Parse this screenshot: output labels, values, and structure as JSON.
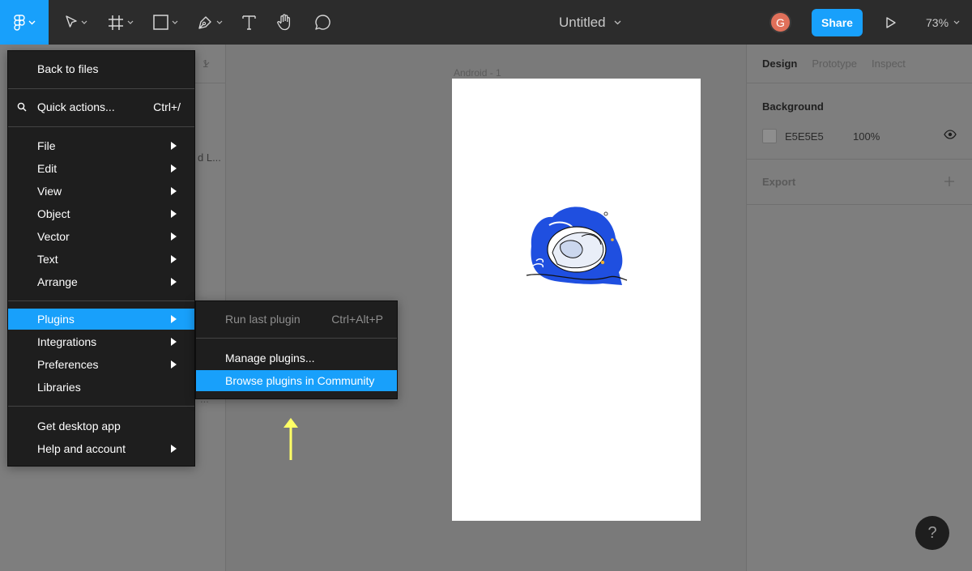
{
  "app": {
    "file_title": "Untitled",
    "avatar_initial": "G",
    "share_label": "Share",
    "zoom_level": "73%",
    "accent_color": "#18a0fb"
  },
  "toolbar": {
    "tools": [
      "figma-menu-icon",
      "move-icon",
      "frame-icon",
      "rectangle-icon",
      "pen-icon",
      "text-icon",
      "hand-icon",
      "comment-icon"
    ]
  },
  "left_panel": {
    "fragment_1": "1",
    "fragment_2": "d L...",
    "fragment_3": "..."
  },
  "canvas": {
    "frame_label": "Android - 1"
  },
  "right_panel": {
    "tabs": [
      "Design",
      "Prototype",
      "Inspect"
    ],
    "background_title": "Background",
    "background_hex": "E5E5E5",
    "background_opacity": "100%",
    "export_title": "Export"
  },
  "main_menu": {
    "back_to_files": "Back to files",
    "quick_actions": "Quick actions...",
    "quick_actions_shortcut": "Ctrl+/",
    "items": [
      "File",
      "Edit",
      "View",
      "Object",
      "Vector",
      "Text",
      "Arrange"
    ],
    "plugins": "Plugins",
    "integrations": "Integrations",
    "preferences": "Preferences",
    "libraries": "Libraries",
    "get_desktop_app": "Get desktop app",
    "help_and_account": "Help and account"
  },
  "plugins_menu": {
    "run_last_plugin": "Run last plugin",
    "run_last_plugin_shortcut": "Ctrl+Alt+P",
    "manage_plugins": "Manage plugins...",
    "browse_plugins": "Browse plugins in Community"
  },
  "help_label": "?"
}
